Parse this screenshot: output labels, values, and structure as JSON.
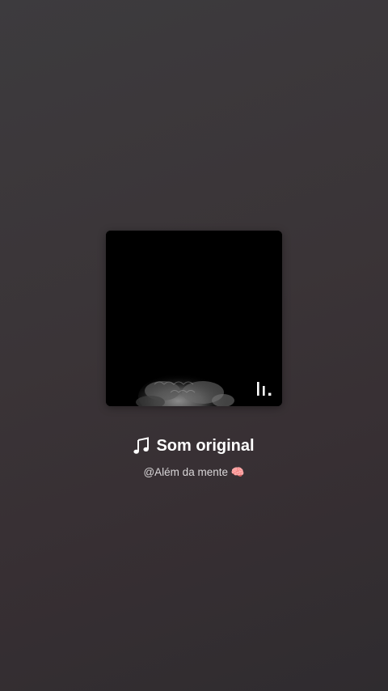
{
  "sound": {
    "title": "Som original",
    "author": "@Além da mente 🧠"
  },
  "icons": {
    "note": "music-note-icon",
    "indicator": "audio-bars-icon"
  },
  "colors": {
    "background_top": "#3d3b3e",
    "background_bottom": "#2f2c2f",
    "title": "#ffffff",
    "author": "#d9d6d8"
  }
}
